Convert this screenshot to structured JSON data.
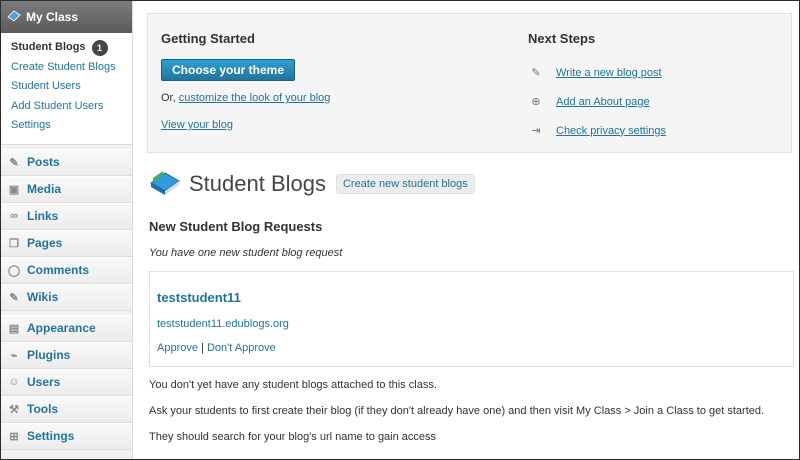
{
  "sidebar": {
    "header": "My Class",
    "submenu": [
      {
        "label": "Student Blogs",
        "badge": "1"
      },
      {
        "label": "Create Student Blogs"
      },
      {
        "label": "Student Users"
      },
      {
        "label": "Add Student Users"
      },
      {
        "label": "Settings"
      }
    ],
    "menu": [
      {
        "label": "Posts",
        "icon": "pin-icon"
      },
      {
        "label": "Media",
        "icon": "media-icon"
      },
      {
        "label": "Links",
        "icon": "link-icon"
      },
      {
        "label": "Pages",
        "icon": "pages-icon"
      },
      {
        "label": "Comments",
        "icon": "comments-icon"
      },
      {
        "label": "Wikis",
        "icon": "pin-icon"
      },
      {
        "label": "Appearance",
        "icon": "appearance-icon"
      },
      {
        "label": "Plugins",
        "icon": "plug-icon"
      },
      {
        "label": "Users",
        "icon": "users-icon"
      },
      {
        "label": "Tools",
        "icon": "tools-icon"
      },
      {
        "label": "Settings",
        "icon": "settings-icon"
      }
    ]
  },
  "welcome": {
    "getting_started": {
      "title": "Getting Started",
      "button": "Choose your theme",
      "or_text": "Or,",
      "customize_link": "customize the look of your blog",
      "view_link": "View your blog"
    },
    "next_steps": {
      "title": "Next Steps",
      "items": [
        {
          "label": "Write a new blog post",
          "icon": "pin-icon"
        },
        {
          "label": "Add an About page",
          "icon": "add-page-icon"
        },
        {
          "label": "Check privacy settings",
          "icon": "privacy-icon"
        }
      ]
    }
  },
  "page": {
    "title": "Student Blogs",
    "add_new": "Create new student blogs",
    "section_title": "New Student Blog Requests",
    "intro": "You have one new student blog request"
  },
  "request": {
    "username": "teststudent11",
    "url": "teststudent11.edublogs.org",
    "approve": "Approve",
    "separator": "|",
    "disapprove": "Don't Approve"
  },
  "messages": {
    "no_blogs": "You don't yet have any student blogs attached to this class.",
    "ask": "Ask your students to first create their blog (if they don't already have one) and then visit My Class > Join a Class to get started.",
    "search": "They should search for your blog's url name to gain access"
  },
  "colors": {
    "link": "#21759b",
    "button": "#21759b",
    "badge": "#464646"
  }
}
